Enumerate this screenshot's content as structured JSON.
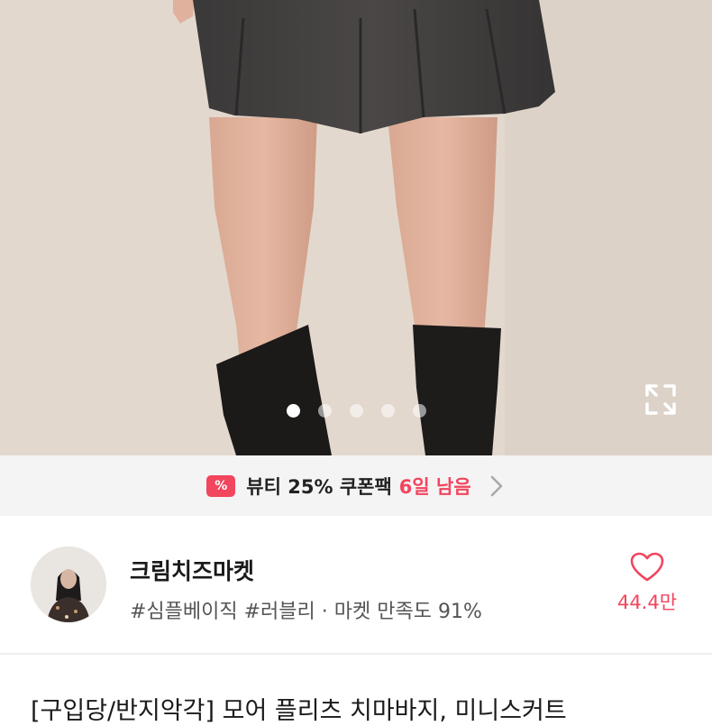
{
  "gallery": {
    "image_alt": "product photo",
    "page_count": 5,
    "active_index": 0,
    "expand_icon": "expand-icon"
  },
  "coupon": {
    "icon_label": "%",
    "text": "뷰티 25% 쿠폰팩",
    "days_left": "6일 남음",
    "accent_color": "#f2455e"
  },
  "seller": {
    "name": "크림치즈마켓",
    "tags": "#심플베이직 #러블리 · 마켓 만족도 91%",
    "likes": "44.4만"
  },
  "product": {
    "title": "[구입당/반지악각] 모어 플리츠 치마바지, 미니스커트"
  }
}
